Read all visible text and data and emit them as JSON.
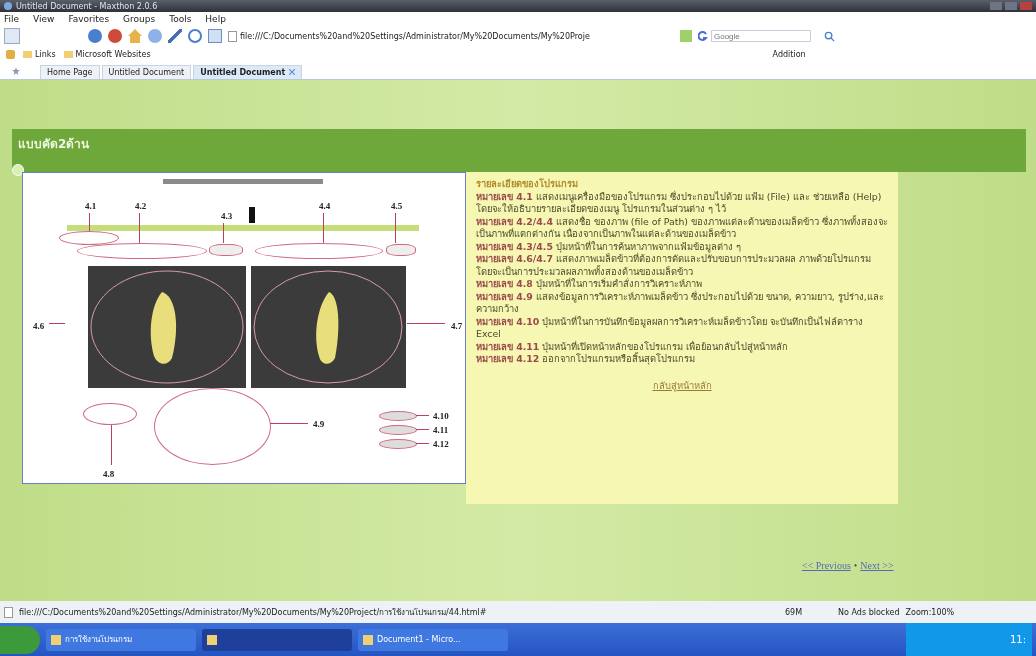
{
  "window": {
    "title": "Untitled Document - Maxthon 2.0.6"
  },
  "menu": [
    "File",
    "View",
    "Favorites",
    "Groups",
    "Tools",
    "Help"
  ],
  "address": {
    "value": "file:///C:/Documents%20and%20Settings/Administrator/My%20Documents/My%20Proje"
  },
  "search": {
    "placeholder": "Google"
  },
  "addition_label": "Addition",
  "links_bar": [
    "Links",
    "Microsoft Websites"
  ],
  "tabs": [
    {
      "label": "Home Page",
      "selected": false,
      "closable": false
    },
    {
      "label": "Untitled Document",
      "selected": false,
      "closable": false
    },
    {
      "label": "Untitled Document",
      "selected": true,
      "closable": true
    }
  ],
  "page": {
    "heading": "แบบคัด2ด้าน",
    "figure": {
      "callouts": [
        "4.1",
        "4.2",
        "4.3",
        "4.4",
        "4.5",
        "4.6",
        "4.7",
        "4.8",
        "4.9",
        "4.10",
        "4.11",
        "4.12"
      ]
    },
    "details": {
      "title": "รายละเอียดของโปรแกรม",
      "items": [
        {
          "label": "หมายเลข 4.1",
          "text": "แสดงเมนูเครื่องมือของโปรแกรม ซึ่งประกอบไปด้วย แฟ้ม (File) และ ช่วยเหลือ (Help) โดยจะให้อธิบายรายละเอียดของเมนู โปรแกรมในส่วนต่าง ๆ ไว้"
        },
        {
          "label": "หมายเลข 4.2/4.4",
          "text": "แสดงชื่อ ของภาพ (file of Path) ของภาพแต่ละด้านของเมล็ดข้าว ซึ่งภาพทั้งสองจะเป็นภาพที่แตกต่างกัน เนื่องจากเป็นภาพในแต่ละด้านของเมล็ดข้าว"
        },
        {
          "label": "หมายเลข 4.3/4.5",
          "text": "ปุ่มหน้าที่ในการค้นหาภาพจากแฟ้มข้อมูลต่าง ๆ"
        },
        {
          "label": "หมายเลข 4.6/4.7",
          "text": "แสดงภาพเมล็ดข้าวที่ต้องการตัดและปรับขอบการประมวลผล ภาพด้วยโปรแกรม โดยจะเป็นการประมวลผลภาพทั้งสองด้านของเมล็ดข้าว"
        },
        {
          "label": "หมายเลข 4.8",
          "text": "ปุ่มหน้าที่ในการเริ่มคำสั่งการวิเคราะห์ภาพ"
        },
        {
          "label": "หมายเลข 4.9",
          "text": "แสดงข้อมูลการวิเคราะห์ภาพเมล็ดข้าว ซึ่งประกอบไปด้วย ขนาด, ความยาว, รูปร่าง,และความกว้าง"
        },
        {
          "label": "หมายเลข 4.10",
          "text": "ปุ่มหน้าที่ในการบันทึกข้อมูลผลการวิเคราะห์เมล็ดข้าวโดย จะบันทึกเป็นไฟล์ตาราง Excel"
        },
        {
          "label": "หมายเลข 4.11",
          "text": "ปุ่มหน้าที่เปิดหน้าหลักของโปรแกรม เพื่อย้อนกลับไปสู่หน้าหลัก"
        },
        {
          "label": "หมายเลข 4.12",
          "text": "ออกจากโปรแกรมหรือสิ้นสุดโปรแกรม"
        }
      ]
    },
    "back_link": "กลับสู่หน้าหลัก",
    "previous": "<< Previous",
    "separator": "•",
    "next": "Next >>"
  },
  "status_bar": {
    "url": "file:///C:/Documents%20and%20Settings/Administrator/My%20Documents/My%20Project/การใช้งานโปรแกรม/44.html#",
    "memory": "69M",
    "ads": "No Ads blocked",
    "zoom": "Zoom:100%"
  },
  "taskbar": {
    "items": [
      {
        "label": "การใช้งานโปรแกรม",
        "selected": false
      },
      {
        "selected": true
      },
      {
        "label": "Document1 - Micro...",
        "selected": false
      }
    ],
    "clock": "11:"
  }
}
